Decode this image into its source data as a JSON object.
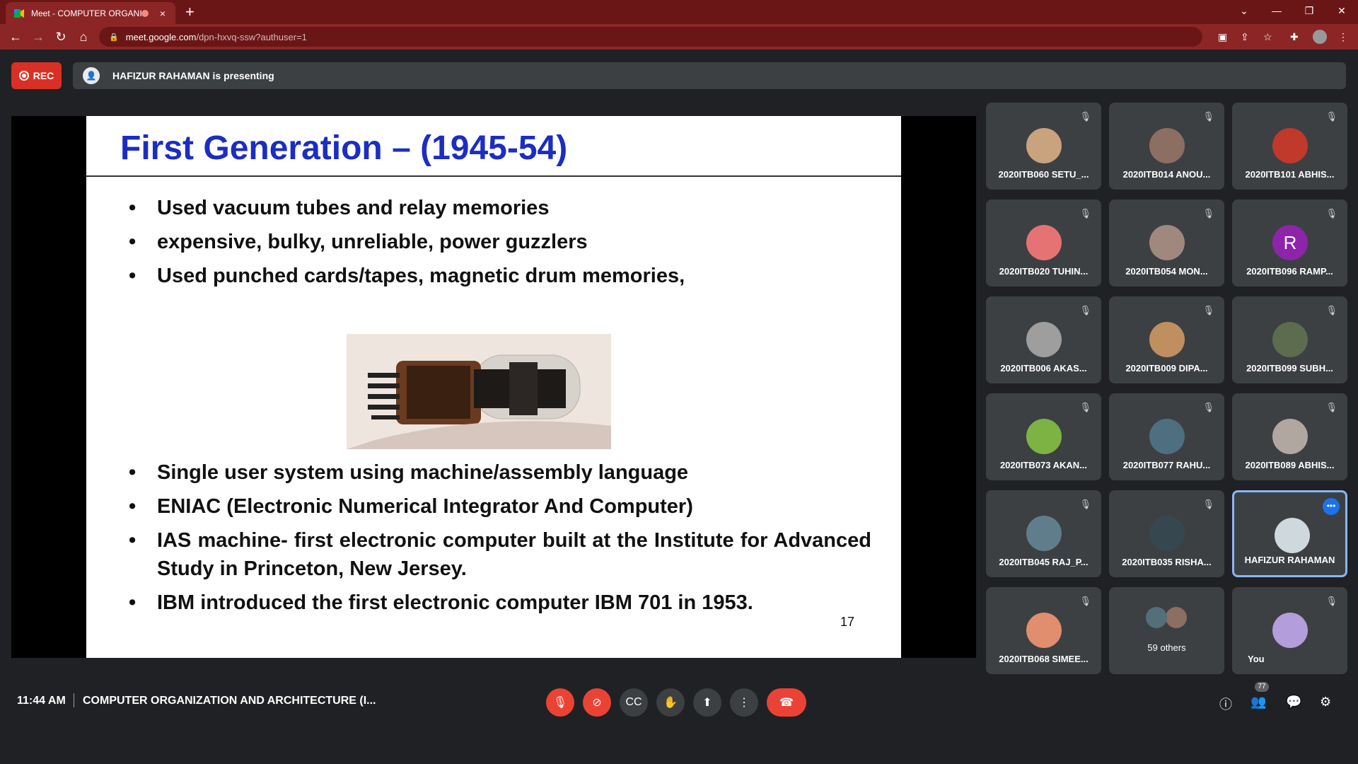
{
  "browser": {
    "tab_title": "Meet - COMPUTER ORGANIZ",
    "url_host": "meet.google.com",
    "url_path": "/dpn-hxvq-ssw?authuser=1",
    "new_tab_symbol": "+",
    "tab_close": "×"
  },
  "meet": {
    "rec_label": "REC",
    "presenting_text": "HAFIZUR RAHAMAN is presenting",
    "time": "11:44 AM",
    "meeting_title": "COMPUTER ORGANIZATION AND ARCHITECTURE (I...",
    "participants_count": "77"
  },
  "slide": {
    "title": "First Generation – (1945-54)",
    "bullets_top": [
      "Used vacuum tubes and relay memories",
      "expensive, bulky, unreliable, power guzzlers",
      "Used punched cards/tapes, magnetic drum memories,"
    ],
    "bullets_bottom": [
      "Single user system using machine/assembly language",
      " ENIAC (Electronic Numerical Integrator And Computer)",
      "IAS machine- first electronic computer built at the Institute for Advanced Study in Princeton, New Jersey.",
      "IBM introduced the first electronic computer IBM 701 in 1953."
    ],
    "page_number": "17"
  },
  "participants": [
    {
      "name": "2020ITB060 SETU_...",
      "color": "#c9a27e"
    },
    {
      "name": "2020ITB014 ANOU...",
      "color": "#8d6e63"
    },
    {
      "name": "2020ITB101 ABHIS...",
      "color": "#c0392b"
    },
    {
      "name": "2020ITB020 TUHIN...",
      "color": "#e57373"
    },
    {
      "name": "2020ITB054 MON...",
      "color": "#a1887f"
    },
    {
      "name": "2020ITB096 RAMP...",
      "color": "#8e24aa",
      "initial": "R"
    },
    {
      "name": "2020ITB006 AKAS...",
      "color": "#9e9e9e"
    },
    {
      "name": "2020ITB009 DIPA...",
      "color": "#bf8f5f"
    },
    {
      "name": "2020ITB099 SUBH...",
      "color": "#5d6b4f"
    },
    {
      "name": "2020ITB073 AKAN...",
      "color": "#7cb342"
    },
    {
      "name": "2020ITB077 RAHU...",
      "color": "#4e6f7f"
    },
    {
      "name": "2020ITB089 ABHIS...",
      "color": "#b0a8a0"
    },
    {
      "name": "2020ITB045 RAJ_P...",
      "color": "#607d8b"
    },
    {
      "name": "2020ITB035 RISHA...",
      "color": "#37474f"
    },
    {
      "name": "HAFIZUR RAHAMAN",
      "color": "#cfd8dc"
    },
    {
      "name": "2020ITB068 SIMEE...",
      "color": "#e08e6d"
    },
    {
      "name": "59 others",
      "color": "#546e7a"
    },
    {
      "name": "You",
      "color": "#b39ddb"
    }
  ]
}
